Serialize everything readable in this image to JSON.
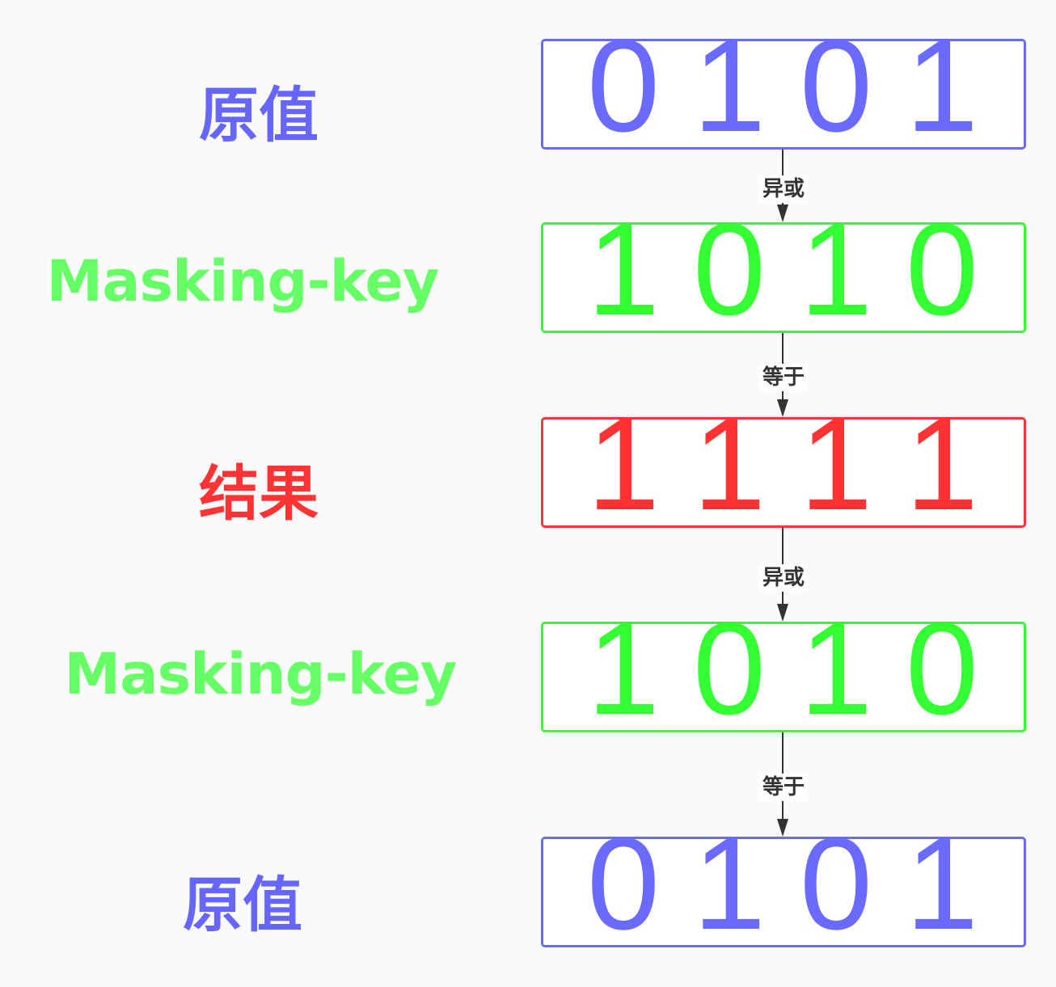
{
  "rows": [
    {
      "label": "原值",
      "bits": [
        "0",
        "1",
        "0",
        "1"
      ],
      "label_color": "#6666ff",
      "box_color": "#6a6aff"
    },
    {
      "label": "Masking-key",
      "bits": [
        "1",
        "0",
        "1",
        "0"
      ],
      "label_color": "#66ff66",
      "box_color": "#33ff33"
    },
    {
      "label": "结果",
      "bits": [
        "1",
        "1",
        "1",
        "1"
      ],
      "label_color": "#ff3333",
      "box_color": "#ff3333"
    },
    {
      "label": "Masking-key",
      "bits": [
        "1",
        "0",
        "1",
        "0"
      ],
      "label_color": "#66ff66",
      "box_color": "#33ff33"
    },
    {
      "label": "原值",
      "bits": [
        "0",
        "1",
        "0",
        "1"
      ],
      "label_color": "#6666ff",
      "box_color": "#6a6aff"
    }
  ],
  "operations": [
    "异或",
    "等于",
    "异或",
    "等于"
  ]
}
